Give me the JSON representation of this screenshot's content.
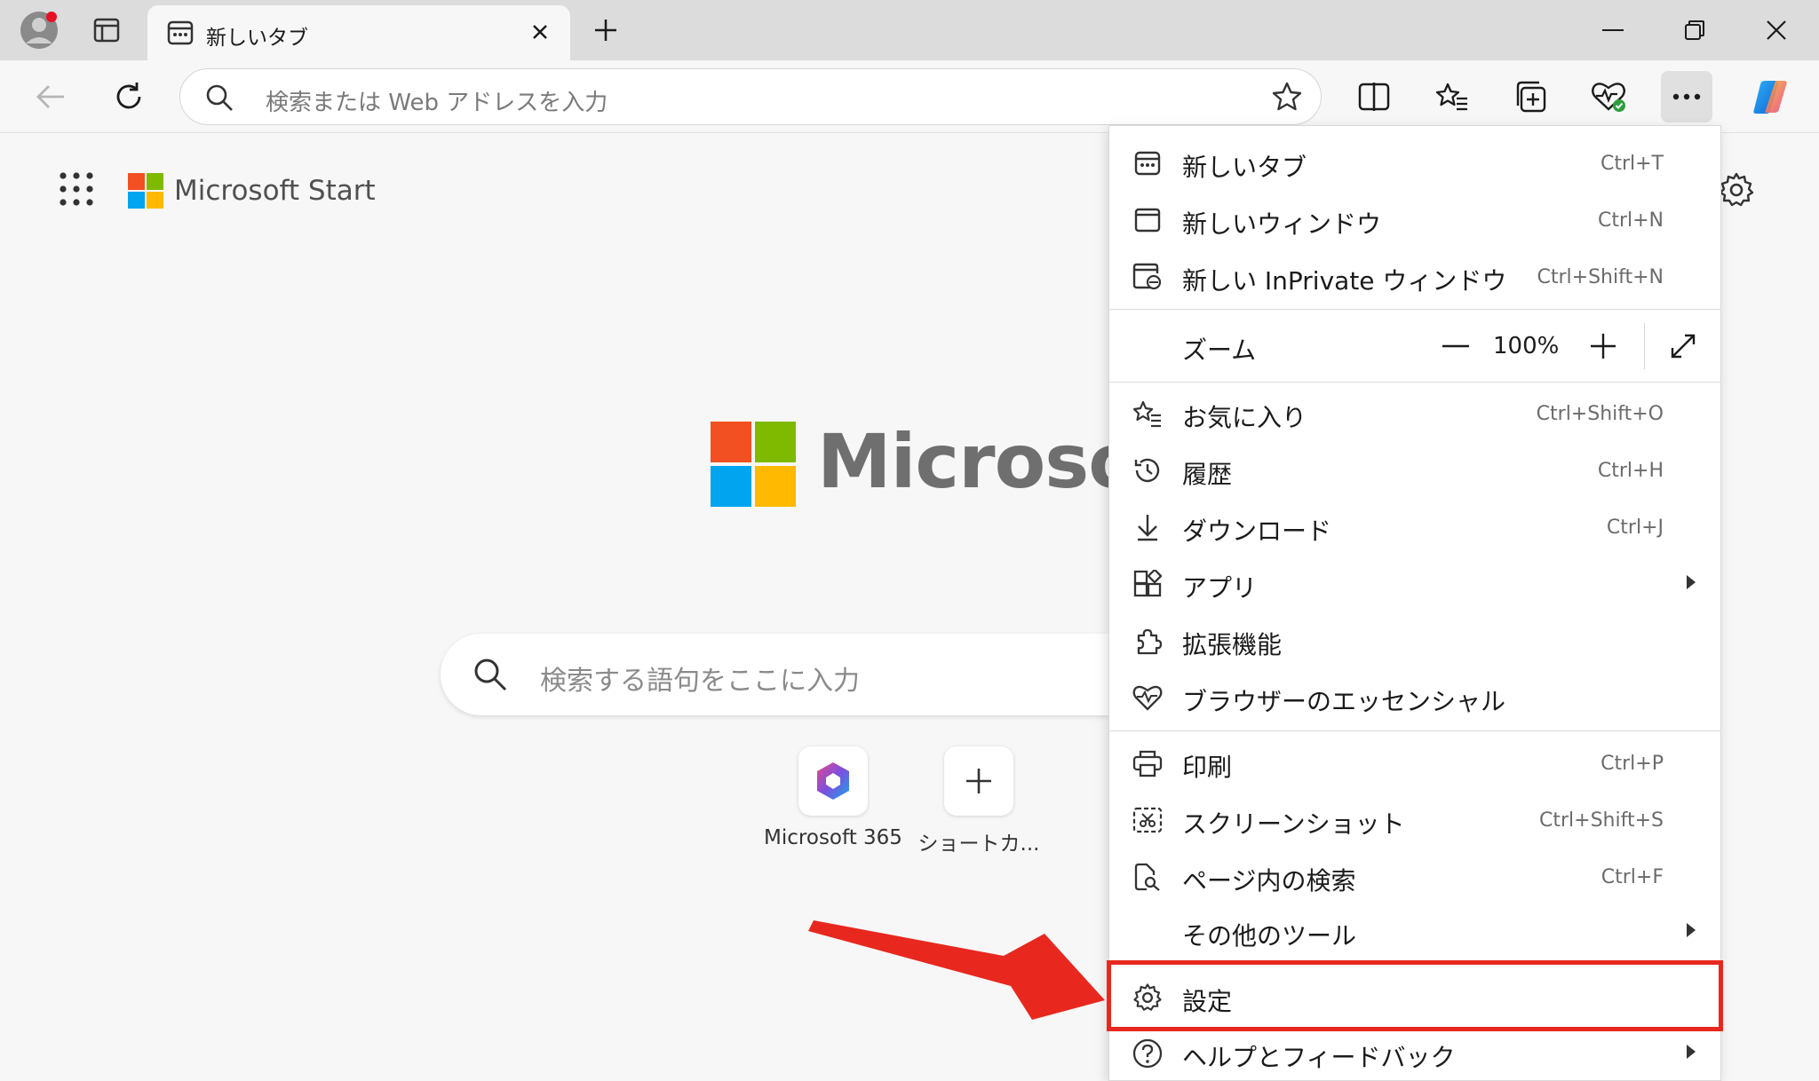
{
  "tab": {
    "title": "新しいタブ"
  },
  "address": {
    "placeholder": "検索または Web アドレスを入力"
  },
  "page": {
    "brand": "Microsoft Start",
    "logo_word": "Microsoft",
    "search_placeholder": "検索する語句をここに入力",
    "shortcuts": [
      {
        "label": "Microsoft 365",
        "icon": "microsoft-365-icon"
      },
      {
        "label": "ショートカ...",
        "icon": "plus-icon"
      }
    ]
  },
  "menu": {
    "items_top": [
      {
        "name": "new-tab",
        "label": "新しいタブ",
        "shortcut": "Ctrl+T",
        "icon": "new-tab-icon"
      },
      {
        "name": "new-window",
        "label": "新しいウィンドウ",
        "shortcut": "Ctrl+N",
        "icon": "window-icon"
      },
      {
        "name": "new-inprivate",
        "label": "新しい InPrivate ウィンドウ",
        "shortcut": "Ctrl+Shift+N",
        "icon": "inprivate-icon"
      }
    ],
    "zoom": {
      "label": "ズーム",
      "value": "100%"
    },
    "items_mid": [
      {
        "name": "favorites",
        "label": "お気に入り",
        "shortcut": "Ctrl+Shift+O",
        "icon": "favorites-icon"
      },
      {
        "name": "history",
        "label": "履歴",
        "shortcut": "Ctrl+H",
        "icon": "history-icon"
      },
      {
        "name": "downloads",
        "label": "ダウンロード",
        "shortcut": "Ctrl+J",
        "icon": "download-icon"
      },
      {
        "name": "apps",
        "label": "アプリ",
        "shortcut": "",
        "icon": "apps-icon"
      },
      {
        "name": "extensions",
        "label": "拡張機能",
        "shortcut": "",
        "icon": "extensions-icon"
      },
      {
        "name": "browser-essentials",
        "label": "ブラウザーのエッセンシャル",
        "shortcut": "",
        "icon": "heart-pulse-icon"
      }
    ],
    "items_bottom": [
      {
        "name": "print",
        "label": "印刷",
        "shortcut": "Ctrl+P",
        "icon": "print-icon"
      },
      {
        "name": "screenshot",
        "label": "スクリーンショット",
        "shortcut": "Ctrl+Shift+S",
        "icon": "screenshot-icon"
      },
      {
        "name": "find-on-page",
        "label": "ページ内の検索",
        "shortcut": "Ctrl+F",
        "icon": "find-icon"
      },
      {
        "name": "more-tools",
        "label": "その他のツール",
        "shortcut": "",
        "icon": ""
      },
      {
        "name": "settings",
        "label": "設定",
        "shortcut": "",
        "icon": "gear-icon"
      },
      {
        "name": "help-feedback",
        "label": "ヘルプとフィードバック",
        "shortcut": "",
        "icon": "help-icon"
      }
    ]
  },
  "colors": {
    "highlight": "#e8281e",
    "ms_red": "#f25022",
    "ms_green": "#7fba00",
    "ms_blue": "#00a4ef",
    "ms_yellow": "#ffb900"
  }
}
